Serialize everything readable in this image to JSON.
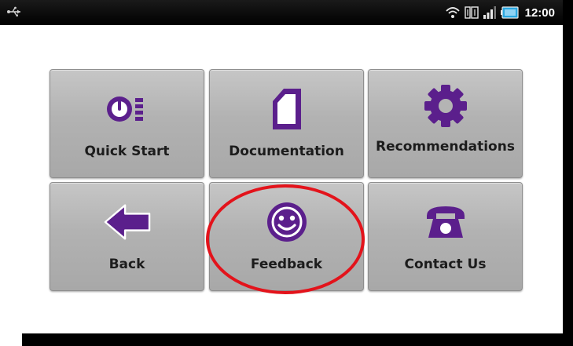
{
  "status_bar": {
    "time": "12:00"
  },
  "colors": {
    "icon_purple": "#5b1f8c",
    "highlight_red": "#e3131b"
  },
  "menu": {
    "tiles": [
      {
        "label": "Quick Start",
        "icon": "speedometer-icon"
      },
      {
        "label": "Documentation",
        "icon": "document-icon"
      },
      {
        "label": "Recommendations",
        "icon": "gear-icon"
      },
      {
        "label": "Back",
        "icon": "arrow-left-icon"
      },
      {
        "label": "Feedback",
        "icon": "smiley-icon"
      },
      {
        "label": "Contact Us",
        "icon": "telephone-icon"
      }
    ]
  }
}
